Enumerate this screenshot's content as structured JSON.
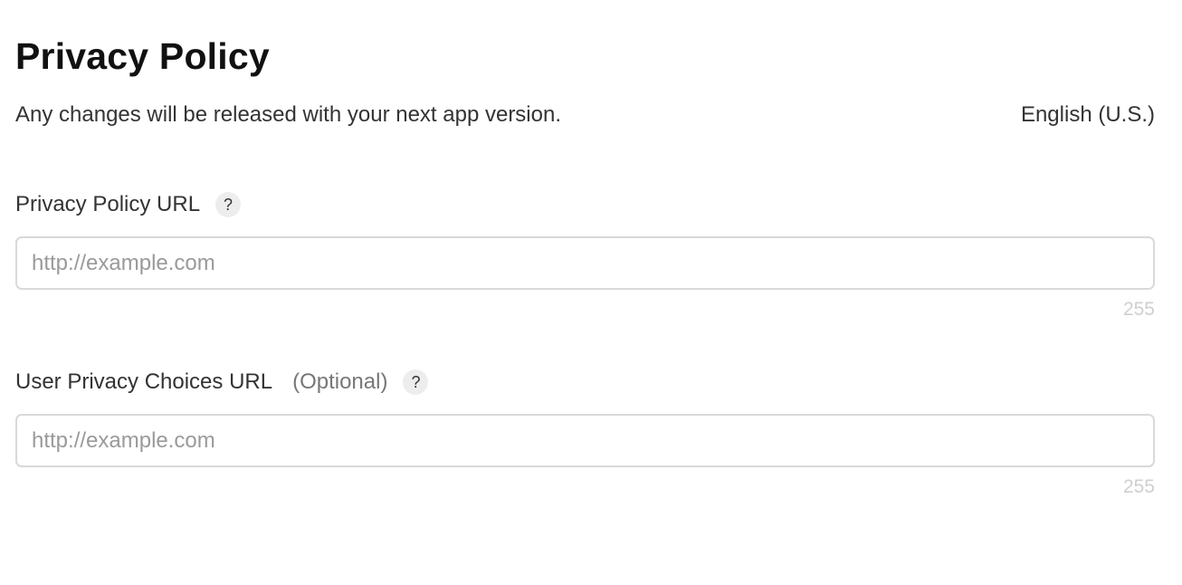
{
  "header": {
    "title": "Privacy Policy",
    "subtitle": "Any changes will be released with your next app version.",
    "language": "English (U.S.)"
  },
  "fields": [
    {
      "label": "Privacy Policy URL",
      "optional": "",
      "help": "?",
      "placeholder": "http://example.com",
      "value": "",
      "char_limit": "255"
    },
    {
      "label": "User Privacy Choices URL",
      "optional": "(Optional)",
      "help": "?",
      "placeholder": "http://example.com",
      "value": "",
      "char_limit": "255"
    }
  ]
}
